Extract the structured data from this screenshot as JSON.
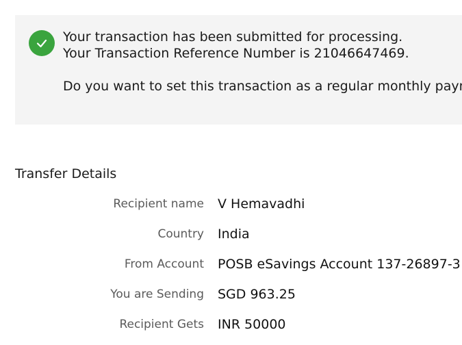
{
  "notice": {
    "icon": "check-circle-icon",
    "accent_color": "#3aa43e",
    "line1": "Your transaction has been submitted for processing.",
    "line2": "Your Transaction Reference Number is 21046647469.",
    "line3": "Do you want to set this transaction as a regular monthly payme"
  },
  "details": {
    "title": "Transfer Details",
    "rows": [
      {
        "label": "Recipient name",
        "value": "V Hemavadhi"
      },
      {
        "label": "Country",
        "value": "India"
      },
      {
        "label": "From Account",
        "value": "POSB eSavings Account 137-26897-3"
      },
      {
        "label": "You are Sending",
        "value": "SGD 963.25"
      },
      {
        "label": "Recipient Gets",
        "value": "INR 50000"
      }
    ]
  }
}
